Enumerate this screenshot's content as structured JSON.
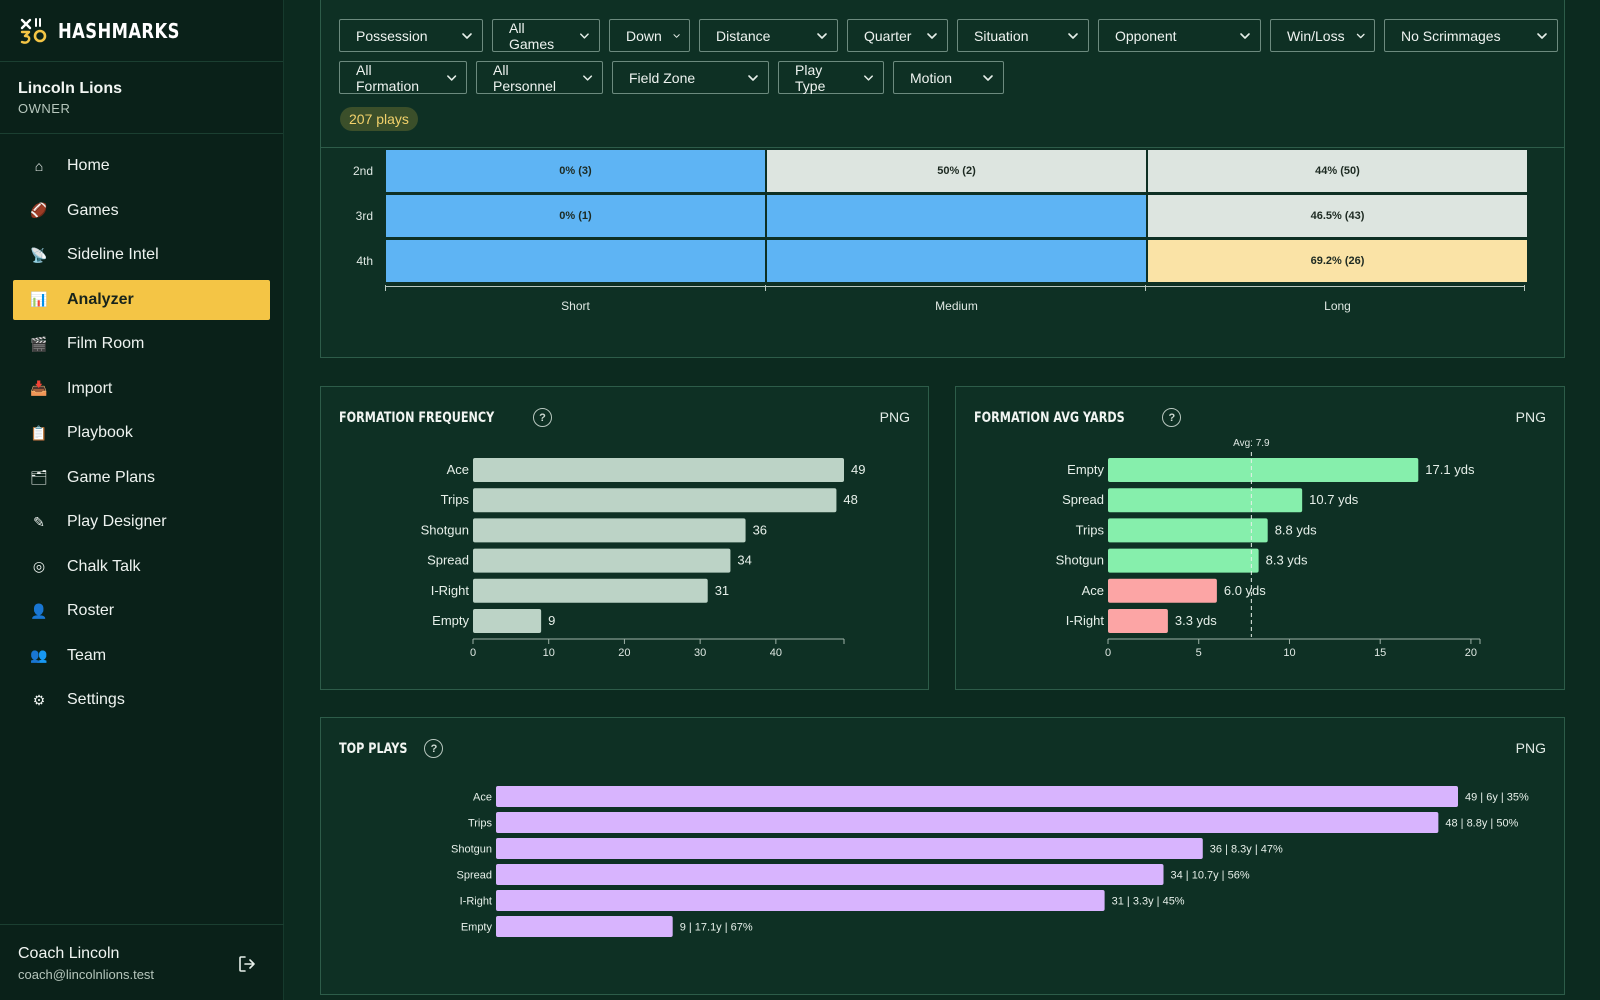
{
  "brand": {
    "name": "HASHMARKS",
    "logo_icon": "hashmark-logo-icon"
  },
  "org": {
    "name": "Lincoln Lions",
    "role": "OWNER"
  },
  "nav": [
    {
      "label": "Home",
      "icon": "house-icon",
      "glyph": "⌂"
    },
    {
      "label": "Games",
      "icon": "football-icon",
      "glyph": "🏈"
    },
    {
      "label": "Sideline Intel",
      "icon": "satellite-icon",
      "glyph": "📡"
    },
    {
      "label": "Analyzer",
      "icon": "bar-chart-icon",
      "glyph": "📊",
      "active": true
    },
    {
      "label": "Film Room",
      "icon": "clapper-icon",
      "glyph": "🎬"
    },
    {
      "label": "Import",
      "icon": "inbox-icon",
      "glyph": "📥"
    },
    {
      "label": "Playbook",
      "icon": "clipboard-icon",
      "glyph": "📋"
    },
    {
      "label": "Game Plans",
      "icon": "folder-icon",
      "glyph": "🗂"
    },
    {
      "label": "Play Designer",
      "icon": "pencil-icon",
      "glyph": "✎"
    },
    {
      "label": "Chalk Talk",
      "icon": "target-icon",
      "glyph": "◎"
    },
    {
      "label": "Roster",
      "icon": "person-icon",
      "glyph": "👤"
    },
    {
      "label": "Team",
      "icon": "people-icon",
      "glyph": "👥"
    },
    {
      "label": "Settings",
      "icon": "gear-icon",
      "glyph": "⚙"
    }
  ],
  "user": {
    "name": "Coach Lincoln",
    "email": "coach@lincolnlions.test",
    "logout_icon": "logout-icon"
  },
  "filters": {
    "row1": [
      "Possession",
      "All Games",
      "Down",
      "Distance",
      "Quarter",
      "Situation",
      "Opponent",
      "Win/Loss",
      "No Scrimmages"
    ],
    "row2": [
      "All Formation",
      "All Personnel",
      "Field Zone",
      "Play Type",
      "Motion"
    ],
    "play_count": "207 plays"
  },
  "heatmap": {
    "rows": [
      "2nd",
      "3rd",
      "4th"
    ],
    "columns": [
      "Short",
      "Medium",
      "Long"
    ],
    "cells": [
      [
        {
          "text": "0% (3)",
          "tone": "blue"
        },
        {
          "text": "50% (2)",
          "tone": "grey"
        },
        {
          "text": "44% (50)",
          "tone": "grey"
        }
      ],
      [
        {
          "text": "0% (1)",
          "tone": "blue"
        },
        {
          "text": "",
          "tone": "blue"
        },
        {
          "text": "46.5% (43)",
          "tone": "grey"
        }
      ],
      [
        {
          "text": "",
          "tone": "blue"
        },
        {
          "text": "",
          "tone": "blue"
        },
        {
          "text": "69.2% (26)",
          "tone": "yellow"
        }
      ]
    ],
    "colors": {
      "blue": "#5eb4f4",
      "grey": "#dde5e0",
      "yellow": "#fae3a6"
    }
  },
  "charts": {
    "freq": {
      "title": "FORMATION FREQUENCY",
      "export": "PNG"
    },
    "yards": {
      "title": "FORMATION AVG YARDS",
      "export": "PNG"
    },
    "top": {
      "title": "TOP PLAYS",
      "export": "PNG"
    }
  },
  "chart_data": [
    {
      "id": "formation-frequency",
      "type": "bar",
      "orientation": "horizontal",
      "title": "FORMATION FREQUENCY",
      "categories": [
        "Ace",
        "Trips",
        "Shotgun",
        "Spread",
        "I-Right",
        "Empty"
      ],
      "values": [
        49,
        48,
        36,
        34,
        31,
        9
      ],
      "labels": [
        "49",
        "48",
        "36",
        "34",
        "31",
        "9"
      ],
      "xticks": [
        0,
        10,
        20,
        30,
        40
      ],
      "xlim": [
        0,
        49
      ],
      "color": "#bcd3c6",
      "grid": false
    },
    {
      "id": "formation-avg-yards",
      "type": "bar",
      "orientation": "horizontal",
      "title": "FORMATION AVG YARDS",
      "categories": [
        "Empty",
        "Spread",
        "Trips",
        "Shotgun",
        "Ace",
        "I-Right"
      ],
      "values": [
        17.1,
        10.7,
        8.8,
        8.3,
        6.0,
        3.3
      ],
      "labels": [
        "17.1 yds",
        "10.7 yds",
        "8.8 yds",
        "8.3 yds",
        "6.0 yds",
        "3.3 yds"
      ],
      "colors": [
        "#86efac",
        "#86efac",
        "#86efac",
        "#86efac",
        "#fca5a5",
        "#fca5a5"
      ],
      "xticks": [
        0,
        5,
        10,
        15,
        20
      ],
      "xlim": [
        0,
        20.5
      ],
      "reference_line": {
        "value": 7.9,
        "label": "Avg: 7.9"
      },
      "grid": false
    },
    {
      "id": "top-plays",
      "type": "bar",
      "orientation": "horizontal",
      "title": "TOP PLAYS",
      "categories": [
        "Ace",
        "Trips",
        "Shotgun",
        "Spread",
        "I-Right",
        "Empty"
      ],
      "values": [
        49,
        48,
        36,
        34,
        31,
        9
      ],
      "labels": [
        "49 | 6y | 35%",
        "48 | 8.8y | 50%",
        "36 | 8.3y | 47%",
        "34 | 10.7y | 56%",
        "31 | 3.3y | 45%",
        "9 | 17.1y | 67%"
      ],
      "xlim": [
        0,
        49
      ],
      "color": "#d8b4fe",
      "grid": false
    }
  ]
}
